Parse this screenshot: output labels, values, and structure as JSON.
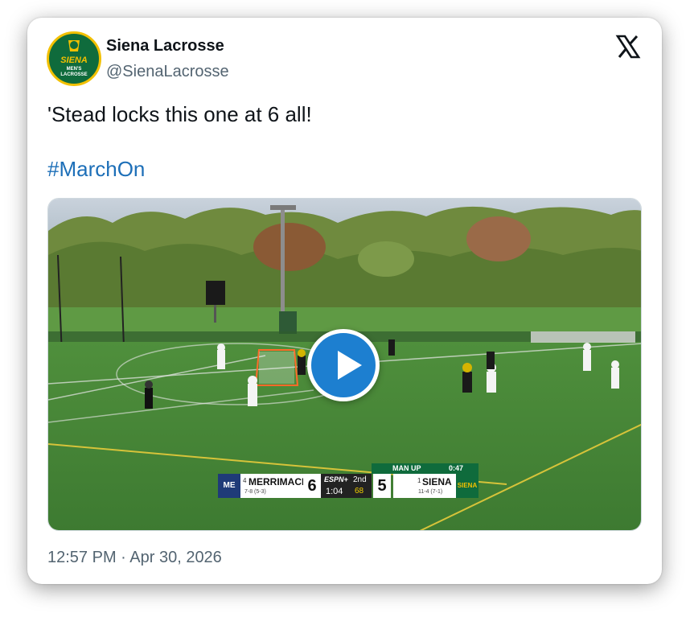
{
  "tweet": {
    "author_name": "Siena Lacrosse",
    "author_handle": "@SienaLacrosse",
    "avatar_text": [
      "SIENA",
      "MEN'S",
      "LACROSSE"
    ],
    "text": "'Stead locks this one at 6 all!",
    "hashtag": "#MarchOn",
    "timestamp": "12:57 PM · Apr 30, 2026"
  },
  "scoreboard": {
    "away": {
      "rank": "4",
      "team": "MERRIMACK",
      "record": "7-8 (5-3)",
      "score": "6",
      "logo": "ME"
    },
    "network": "ESPN+",
    "period": "2nd",
    "clock": "1:04",
    "shot_clock": "68",
    "home": {
      "rank": "1",
      "team": "SIENA",
      "record": "11-4 (7-1)",
      "score": "5",
      "logo": "SIENA"
    },
    "banner": {
      "label": "MAN UP",
      "time": "0:47"
    }
  },
  "colors": {
    "link": "#1d6fb8",
    "play_button": "#1d7fd0",
    "siena_green": "#0f6b3c",
    "siena_gold": "#f2c000"
  },
  "icons": {
    "platform": "x-logo-icon",
    "media_control": "play-icon"
  }
}
